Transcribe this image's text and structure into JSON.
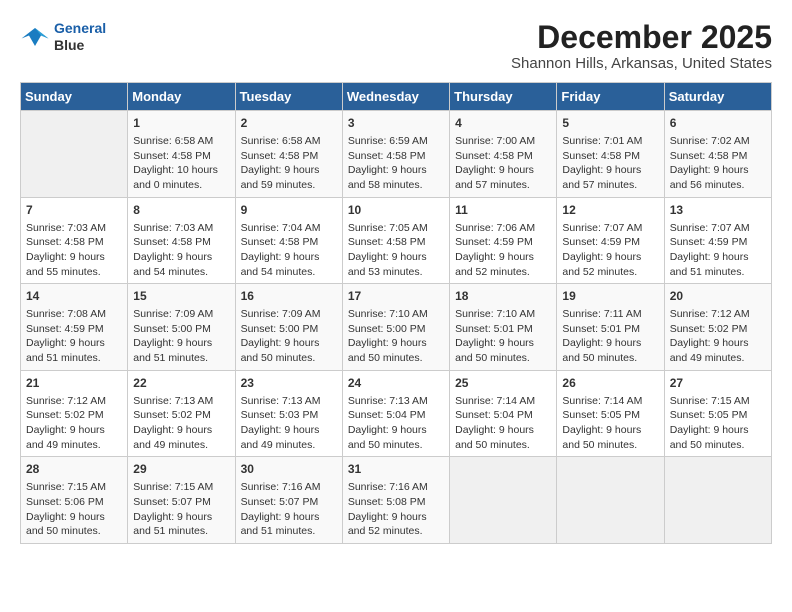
{
  "header": {
    "logo_line1": "General",
    "logo_line2": "Blue",
    "month_year": "December 2025",
    "location": "Shannon Hills, Arkansas, United States"
  },
  "days_of_week": [
    "Sunday",
    "Monday",
    "Tuesday",
    "Wednesday",
    "Thursday",
    "Friday",
    "Saturday"
  ],
  "weeks": [
    [
      {
        "day": "",
        "info": ""
      },
      {
        "day": "1",
        "info": "Sunrise: 6:58 AM\nSunset: 4:58 PM\nDaylight: 10 hours\nand 0 minutes."
      },
      {
        "day": "2",
        "info": "Sunrise: 6:58 AM\nSunset: 4:58 PM\nDaylight: 9 hours\nand 59 minutes."
      },
      {
        "day": "3",
        "info": "Sunrise: 6:59 AM\nSunset: 4:58 PM\nDaylight: 9 hours\nand 58 minutes."
      },
      {
        "day": "4",
        "info": "Sunrise: 7:00 AM\nSunset: 4:58 PM\nDaylight: 9 hours\nand 57 minutes."
      },
      {
        "day": "5",
        "info": "Sunrise: 7:01 AM\nSunset: 4:58 PM\nDaylight: 9 hours\nand 57 minutes."
      },
      {
        "day": "6",
        "info": "Sunrise: 7:02 AM\nSunset: 4:58 PM\nDaylight: 9 hours\nand 56 minutes."
      }
    ],
    [
      {
        "day": "7",
        "info": "Sunrise: 7:03 AM\nSunset: 4:58 PM\nDaylight: 9 hours\nand 55 minutes."
      },
      {
        "day": "8",
        "info": "Sunrise: 7:03 AM\nSunset: 4:58 PM\nDaylight: 9 hours\nand 54 minutes."
      },
      {
        "day": "9",
        "info": "Sunrise: 7:04 AM\nSunset: 4:58 PM\nDaylight: 9 hours\nand 54 minutes."
      },
      {
        "day": "10",
        "info": "Sunrise: 7:05 AM\nSunset: 4:58 PM\nDaylight: 9 hours\nand 53 minutes."
      },
      {
        "day": "11",
        "info": "Sunrise: 7:06 AM\nSunset: 4:59 PM\nDaylight: 9 hours\nand 52 minutes."
      },
      {
        "day": "12",
        "info": "Sunrise: 7:07 AM\nSunset: 4:59 PM\nDaylight: 9 hours\nand 52 minutes."
      },
      {
        "day": "13",
        "info": "Sunrise: 7:07 AM\nSunset: 4:59 PM\nDaylight: 9 hours\nand 51 minutes."
      }
    ],
    [
      {
        "day": "14",
        "info": "Sunrise: 7:08 AM\nSunset: 4:59 PM\nDaylight: 9 hours\nand 51 minutes."
      },
      {
        "day": "15",
        "info": "Sunrise: 7:09 AM\nSunset: 5:00 PM\nDaylight: 9 hours\nand 51 minutes."
      },
      {
        "day": "16",
        "info": "Sunrise: 7:09 AM\nSunset: 5:00 PM\nDaylight: 9 hours\nand 50 minutes."
      },
      {
        "day": "17",
        "info": "Sunrise: 7:10 AM\nSunset: 5:00 PM\nDaylight: 9 hours\nand 50 minutes."
      },
      {
        "day": "18",
        "info": "Sunrise: 7:10 AM\nSunset: 5:01 PM\nDaylight: 9 hours\nand 50 minutes."
      },
      {
        "day": "19",
        "info": "Sunrise: 7:11 AM\nSunset: 5:01 PM\nDaylight: 9 hours\nand 50 minutes."
      },
      {
        "day": "20",
        "info": "Sunrise: 7:12 AM\nSunset: 5:02 PM\nDaylight: 9 hours\nand 49 minutes."
      }
    ],
    [
      {
        "day": "21",
        "info": "Sunrise: 7:12 AM\nSunset: 5:02 PM\nDaylight: 9 hours\nand 49 minutes."
      },
      {
        "day": "22",
        "info": "Sunrise: 7:13 AM\nSunset: 5:02 PM\nDaylight: 9 hours\nand 49 minutes."
      },
      {
        "day": "23",
        "info": "Sunrise: 7:13 AM\nSunset: 5:03 PM\nDaylight: 9 hours\nand 49 minutes."
      },
      {
        "day": "24",
        "info": "Sunrise: 7:13 AM\nSunset: 5:04 PM\nDaylight: 9 hours\nand 50 minutes."
      },
      {
        "day": "25",
        "info": "Sunrise: 7:14 AM\nSunset: 5:04 PM\nDaylight: 9 hours\nand 50 minutes."
      },
      {
        "day": "26",
        "info": "Sunrise: 7:14 AM\nSunset: 5:05 PM\nDaylight: 9 hours\nand 50 minutes."
      },
      {
        "day": "27",
        "info": "Sunrise: 7:15 AM\nSunset: 5:05 PM\nDaylight: 9 hours\nand 50 minutes."
      }
    ],
    [
      {
        "day": "28",
        "info": "Sunrise: 7:15 AM\nSunset: 5:06 PM\nDaylight: 9 hours\nand 50 minutes."
      },
      {
        "day": "29",
        "info": "Sunrise: 7:15 AM\nSunset: 5:07 PM\nDaylight: 9 hours\nand 51 minutes."
      },
      {
        "day": "30",
        "info": "Sunrise: 7:16 AM\nSunset: 5:07 PM\nDaylight: 9 hours\nand 51 minutes."
      },
      {
        "day": "31",
        "info": "Sunrise: 7:16 AM\nSunset: 5:08 PM\nDaylight: 9 hours\nand 52 minutes."
      },
      {
        "day": "",
        "info": ""
      },
      {
        "day": "",
        "info": ""
      },
      {
        "day": "",
        "info": ""
      }
    ]
  ]
}
